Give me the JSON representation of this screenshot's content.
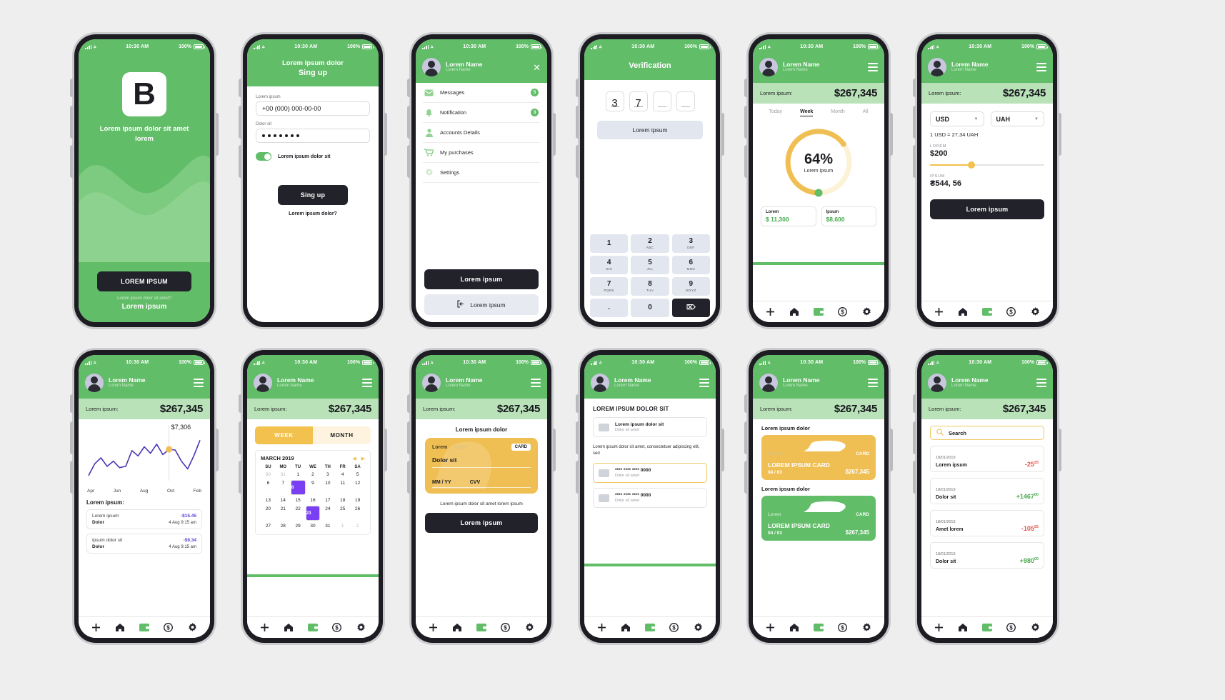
{
  "statusbar": {
    "time": "10:30 AM",
    "battery": "100%"
  },
  "colors": {
    "green": "#62bd69",
    "light_green": "#b9e2b8",
    "yellow": "#f0bf54",
    "dark": "#22222a",
    "purple": "#5b3fd6",
    "red": "#e0574f"
  },
  "common": {
    "user_name": "Lorem Name",
    "user_sub": "Lorem Name",
    "balance_label": "Lorem ipsum:",
    "balance_value": "$267,345"
  },
  "screen1_splash": {
    "logo": "B",
    "tagline": "Lorem ipsum dolor sit amet lorem",
    "cta": "LOREM IPSUM",
    "sub_question": "Lorem ipsum dolor sit amet?",
    "sub_link": "Lorem ipsum"
  },
  "screen2_signup": {
    "header_line1": "Lorem ipsum dolor",
    "header_line2": "Sing up",
    "field1_label": "Lorem ipsum",
    "field1_value": "+00 (000) 000-00-00",
    "field2_label": "Dolor sit",
    "field2_value": "•••••••",
    "toggle_label": "Lorem ipsum dolor sit",
    "toggle_on": true,
    "submit": "Sing up",
    "footer": "Lorem ipsum dolor?"
  },
  "screen3_menu": {
    "close_icon": "close-icon",
    "items": [
      {
        "label": "Messages",
        "icon": "mail-icon",
        "badge": "5"
      },
      {
        "label": "Notification",
        "icon": "bell-icon",
        "badge": "3"
      },
      {
        "label": "Accounts Details",
        "icon": "person-icon",
        "badge": ""
      },
      {
        "label": "My purchases",
        "icon": "cart-icon",
        "badge": ""
      },
      {
        "label": "Settings",
        "icon": "gear-icon",
        "badge": ""
      }
    ],
    "primary_btn": "Lorem ipsum",
    "secondary_btn": "Lorem ipsum"
  },
  "screen4_verification": {
    "title": "Verification",
    "code": [
      "3",
      "7",
      "",
      ""
    ],
    "action_btn": "Lorem ipsum",
    "keys": [
      {
        "n": "1",
        "l": ""
      },
      {
        "n": "2",
        "l": "ABC"
      },
      {
        "n": "3",
        "l": "DEF"
      },
      {
        "n": "4",
        "l": "GHI"
      },
      {
        "n": "5",
        "l": "JKL"
      },
      {
        "n": "6",
        "l": "MNO"
      },
      {
        "n": "7",
        "l": "PQRS"
      },
      {
        "n": "8",
        "l": "TUV"
      },
      {
        "n": "9",
        "l": "WXYZ"
      },
      {
        "n": ".",
        "l": ""
      },
      {
        "n": "0",
        "l": ""
      },
      {
        "n": "⌦",
        "l": ""
      }
    ]
  },
  "screen5_donut": {
    "tabs": [
      "Today",
      "Week",
      "Month",
      "All"
    ],
    "active_tab": "Week",
    "percent": "64%",
    "percent_label": "Lorem ipsum",
    "kpi1_label": "Lorem",
    "kpi1_value": "$ 11,300",
    "kpi2_label": "Ipsum",
    "kpi2_value": "$8,600"
  },
  "screen6_exchange": {
    "from_currency": "USD",
    "to_currency": "UAH",
    "rate": "1 USD = 27,34 UAH",
    "amount_caption": "LOREM",
    "amount_value": "$200",
    "result_caption": "IPSUM",
    "result_value": "₴544, 56",
    "slider_percent": 35,
    "submit": "Lorem ipsum"
  },
  "screen7_chart": {
    "section_title": "Lorem ipsum:",
    "transactions": [
      {
        "name": "Lorem ipsum",
        "amount": "-$15.45",
        "sub": "Dolor",
        "time": "4 Aug  9:15 am"
      },
      {
        "name": "Ipsum dolor sit",
        "amount": "-$9.34",
        "sub": "Dolor",
        "time": "4 Aug  9:15 am"
      }
    ],
    "chart_data": {
      "type": "line",
      "title": "",
      "xlabel": "",
      "ylabel": "",
      "annotation": "$7,306",
      "marker_index": 13,
      "xticks": [
        "Apr",
        "Jun",
        "Aug",
        "Oct",
        "Feb"
      ],
      "x": [
        0,
        1,
        2,
        3,
        4,
        5,
        6,
        7,
        8,
        9,
        10,
        11,
        12,
        13,
        14,
        15,
        16,
        17,
        18
      ],
      "values": [
        8,
        26,
        35,
        22,
        30,
        20,
        22,
        46,
        38,
        52,
        42,
        56,
        40,
        48,
        47,
        30,
        18,
        38,
        62
      ],
      "ylim": [
        0,
        70
      ],
      "grid": false,
      "series_color": "#4b35b5"
    }
  },
  "screen8_calendar": {
    "tab_week": "WEEK",
    "tab_month": "MONTH",
    "active_tab": "WEEK",
    "month_title": "MARCH 2019",
    "weekdays": [
      "SU",
      "MO",
      "TU",
      "WE",
      "TH",
      "FR",
      "SA"
    ],
    "weeks": [
      [
        {
          "d": "30",
          "m": true
        },
        {
          "d": "31",
          "m": true
        },
        {
          "d": "1"
        },
        {
          "d": "2"
        },
        {
          "d": "3"
        },
        {
          "d": "4"
        },
        {
          "d": "5"
        }
      ],
      [
        {
          "d": "6"
        },
        {
          "d": "7"
        },
        {
          "d": "8",
          "s": true
        },
        {
          "d": "9"
        },
        {
          "d": "10"
        },
        {
          "d": "11"
        },
        {
          "d": "12"
        }
      ],
      [
        {
          "d": "13"
        },
        {
          "d": "14"
        },
        {
          "d": "15"
        },
        {
          "d": "16"
        },
        {
          "d": "17"
        },
        {
          "d": "18"
        },
        {
          "d": "19"
        }
      ],
      [
        {
          "d": "20"
        },
        {
          "d": "21"
        },
        {
          "d": "22"
        },
        {
          "d": "23",
          "s": true
        },
        {
          "d": "24"
        },
        {
          "d": "25"
        },
        {
          "d": "26"
        }
      ],
      [
        {
          "d": "27"
        },
        {
          "d": "28"
        },
        {
          "d": "29"
        },
        {
          "d": "30"
        },
        {
          "d": "31"
        },
        {
          "d": "1",
          "m": true
        },
        {
          "d": "2",
          "m": true
        }
      ]
    ]
  },
  "screen9_card": {
    "title": "Lorem ipsum dolor",
    "card_label_a": "Lorem",
    "card_label_b": "Ipsum",
    "card_chip": "CARD",
    "card_holder": "Dolor sit",
    "card_exp": "MM / YY",
    "card_cvv": "CVV",
    "note": "Lorem ipsum dolor sit amet lorem ipsum",
    "submit": "Lorem ipsum"
  },
  "screen10_payment": {
    "title": "LOREM IPSUM DOLOR SIT",
    "option1_t1": "Lorem ipsum dolor sit",
    "option1_t2": "Dolor sit amet",
    "paragraph": "Lorem ipsum dolor sit amet, consectetuer adipiscing elit, sed",
    "option2_t1": "**** **** **** 0000",
    "option2_t2": "Dolor sit amet",
    "option3_t1": "**** **** **** 0000",
    "option3_t2": "Dolor sit amet"
  },
  "screen11_cards": {
    "label1": "Lorem ipsum dolor",
    "label2": "Lorem ipsum dolor",
    "card1": {
      "brand": "Lorem",
      "chip": "CARD",
      "title": "LOREM IPSUM CARD",
      "date": "04 / 03",
      "value": "$267,345"
    },
    "card2": {
      "brand": "Lorem",
      "chip": "CARD",
      "title": "LOREM IPSUM CARD",
      "date": "04 / 03",
      "value": "$267,345"
    }
  },
  "screen12_history": {
    "search_placeholder": "Search",
    "rows": [
      {
        "date": "18/01/2019",
        "name": "Lorem ipsum",
        "amount": "-25",
        "cents": "25",
        "sign": "neg"
      },
      {
        "date": "18/01/2019",
        "name": "Dolor sit",
        "amount": "+1467",
        "cents": "00",
        "sign": "pos"
      },
      {
        "date": "18/01/2019",
        "name": "Amet lorem",
        "amount": "-105",
        "cents": "25",
        "sign": "neg"
      },
      {
        "date": "18/01/2019",
        "name": "Dolor sit",
        "amount": "+980",
        "cents": "00",
        "sign": "pos"
      }
    ]
  },
  "navbar": {
    "items": [
      "plus-icon",
      "home-icon",
      "wallet-icon",
      "dollar-icon",
      "gear-icon"
    ]
  }
}
